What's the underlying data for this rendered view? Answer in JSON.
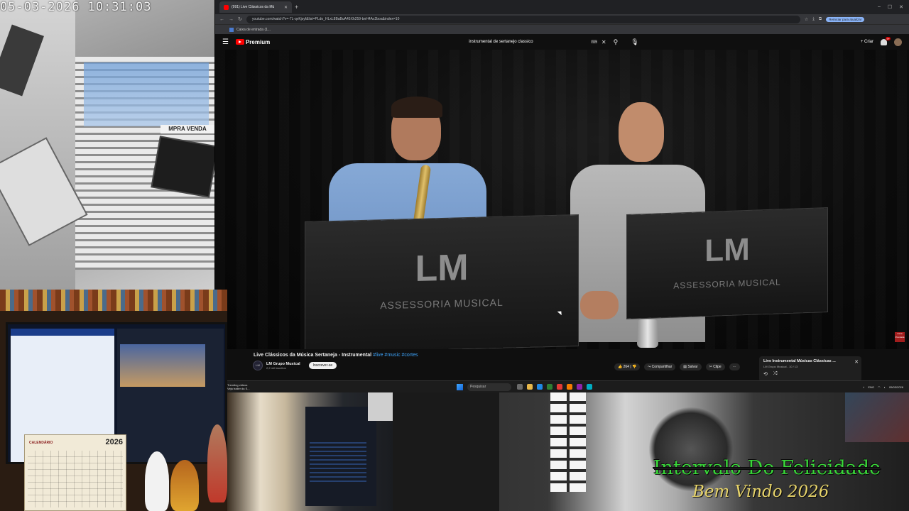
{
  "camera_top_left": {
    "timestamp": "05-03-2026 10:31:03",
    "shop_sign": "MPRA VENDA"
  },
  "browser": {
    "tab": {
      "title": "(991) Live Clássicos da Mú"
    },
    "url": "youtube.com/watch?v=-7L-qvKjsyf&list=PLdo_HLxL8BaBuA45Xh259-bnH4Ax2boa&index=10",
    "bookmark": "Caixa de entrada (1...",
    "update_label": "Reiniciar para atualizar"
  },
  "youtube": {
    "logo_text": "Premium",
    "search_query": "instrumental de sertanejo classico",
    "create_label": "Criar",
    "notification_count": "9+"
  },
  "video": {
    "stand_logo": "LM",
    "stand_brand": "ASSESSORIA MUSICAL",
    "watermark": "Cena Premiada"
  },
  "video_info": {
    "title": "Live Clássicos da Música Sertaneja - Instrumental",
    "hashtags": "#live #music #cortes",
    "channel_name": "LM Grupo Musical",
    "subscribers": "2,2 mil inscritos",
    "subscribe_label": "Inscrever-se",
    "like_count": "264",
    "share_label": "Compartilhar",
    "save_label": "Salvar",
    "clip_label": "Clipe",
    "more_label": "⋯"
  },
  "playlist": {
    "title": "Live Instrumental Músicas Clássicas ...",
    "subtitle": "LM Grupo Musical - 10 / 13"
  },
  "taskbar": {
    "weather_line1": "Trending videos",
    "weather_line2": "Veja trailer da S...",
    "search_placeholder": "Pesquisar",
    "lang": "ENG",
    "date": "05/03/2026"
  },
  "calendar": {
    "label": "CALENDÁRIO",
    "year": "2026"
  },
  "overlay": {
    "line1": "Intervalo Do Felicidade",
    "line2": "Bem Vindo 2026"
  }
}
